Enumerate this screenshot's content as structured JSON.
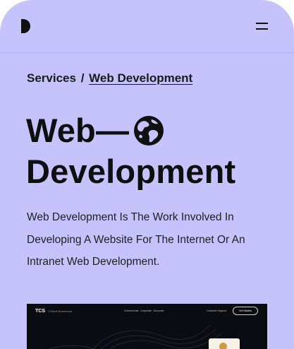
{
  "header": {
    "logo_icon": "half-circle-logo-icon",
    "menu_icon": "hamburger-menu-icon"
  },
  "breadcrumb": {
    "parent": "Services",
    "separator": "/",
    "current": "Web Development"
  },
  "hero": {
    "title_line1": "Web—",
    "title_icon": "globe-icon",
    "title_line2": "Development"
  },
  "description": "Web Development Is The Work Involved In Developing A Website For The Internet Or An Intranet Web Development.",
  "preview": {
    "brand": "TCS",
    "tagline": "// VisionPrimeservices",
    "nav": "Commercials · Corporate · Accounts",
    "support": "Customer Support",
    "cta": "Get Started"
  },
  "colors": {
    "background": "#c6c2fb",
    "text": "#111111",
    "preview_background": "#0b0b12"
  }
}
